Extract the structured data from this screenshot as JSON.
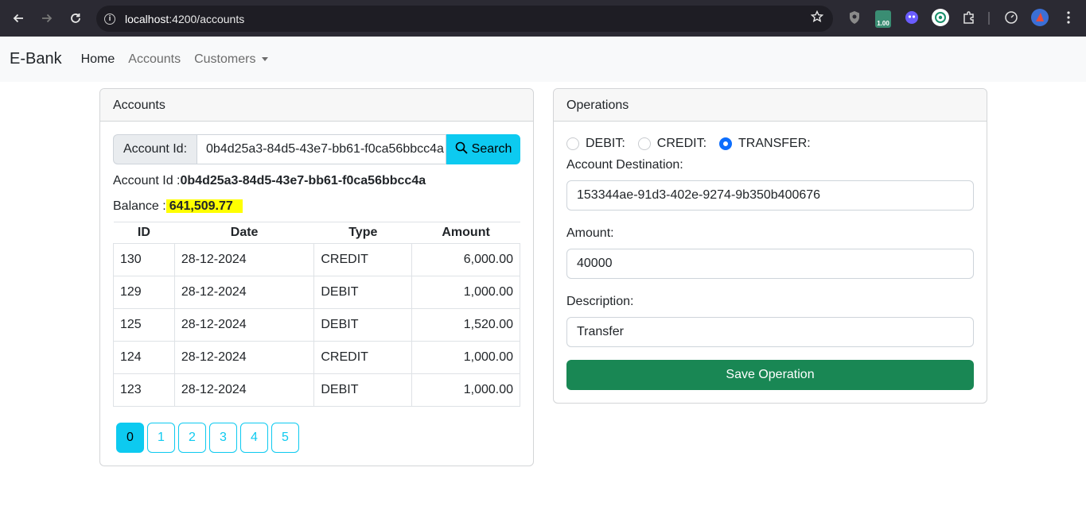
{
  "browser": {
    "url_host": "localhost",
    "url_rest": ":4200/accounts",
    "badge_text": "1.00",
    "icons": [
      "back-icon",
      "forward-icon",
      "reload-icon",
      "info-icon",
      "star-icon",
      "shield-icon",
      "extension-badge-icon",
      "ghost-icon",
      "chatgpt-icon",
      "puzzle-icon",
      "speed-icon",
      "profile-icon",
      "menu-icon"
    ]
  },
  "navbar": {
    "brand": "E-Bank",
    "links": [
      {
        "label": "Home",
        "active": true
      },
      {
        "label": "Accounts",
        "active": false
      },
      {
        "label": "Customers",
        "active": false
      }
    ]
  },
  "accounts": {
    "header": "Accounts",
    "search_label": "Account Id:",
    "search_value": "0b4d25a3-84d5-43e7-bb61-f0ca56bbcc4a",
    "search_button": "Search",
    "account_id_label": "Account Id :",
    "account_id": "0b4d25a3-84d5-43e7-bb61-f0ca56bbcc4a",
    "balance_label": "Balance :",
    "balance": "641,509.77",
    "columns": [
      "ID",
      "Date",
      "Type",
      "Amount"
    ],
    "rows": [
      {
        "id": "130",
        "date": "28-12-2024",
        "type": "CREDIT",
        "amount": "6,000.00"
      },
      {
        "id": "129",
        "date": "28-12-2024",
        "type": "DEBIT",
        "amount": "1,000.00"
      },
      {
        "id": "125",
        "date": "28-12-2024",
        "type": "DEBIT",
        "amount": "1,520.00"
      },
      {
        "id": "124",
        "date": "28-12-2024",
        "type": "CREDIT",
        "amount": "1,000.00"
      },
      {
        "id": "123",
        "date": "28-12-2024",
        "type": "DEBIT",
        "amount": "1,000.00"
      }
    ],
    "pages": [
      "0",
      "1",
      "2",
      "3",
      "4",
      "5"
    ],
    "current_page": "0"
  },
  "operations": {
    "header": "Operations",
    "radios": [
      {
        "label": "DEBIT:",
        "checked": false
      },
      {
        "label": "CREDIT:",
        "checked": false
      },
      {
        "label": "TRANSFER:",
        "checked": true
      }
    ],
    "destination_label": "Account Destination:",
    "destination_value": "153344ae-91d3-402e-9274-9b350b400676",
    "amount_label": "Amount:",
    "amount_value": "40000",
    "description_label": "Description:",
    "description_value": "Transfer",
    "save_button": "Save Operation"
  },
  "colors": {
    "info": "#0dcaf0",
    "success": "#198754",
    "primary": "#0d6efd",
    "highlight": "#ffff00"
  }
}
